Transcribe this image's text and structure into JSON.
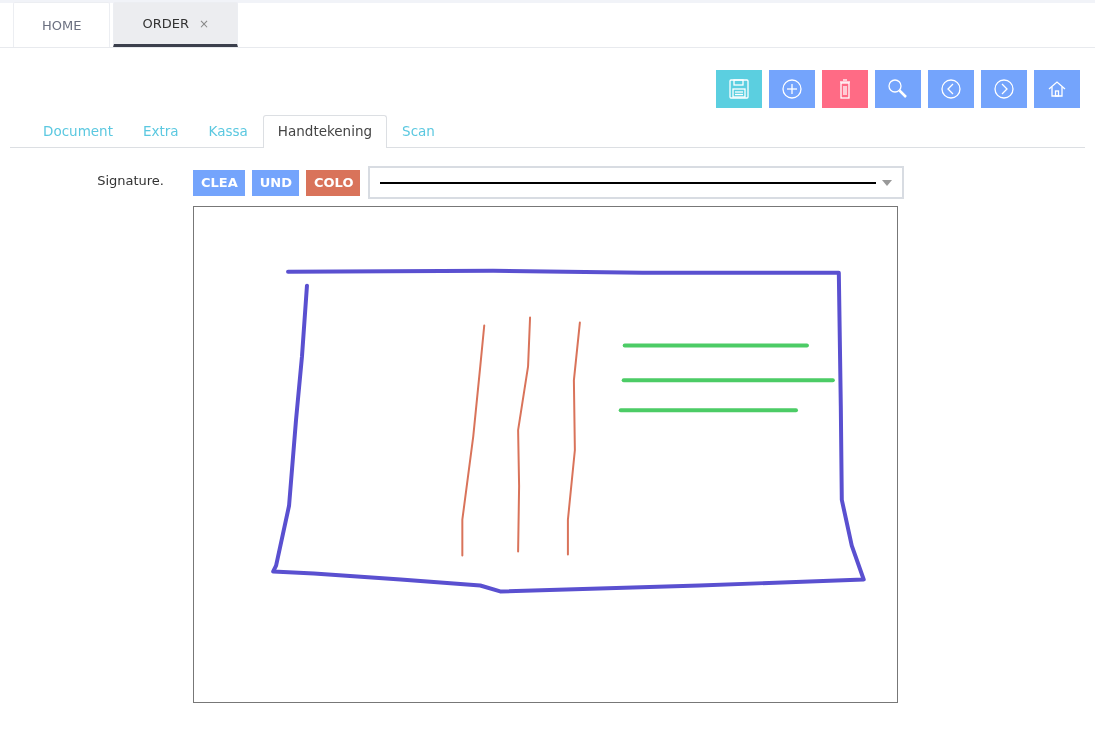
{
  "tabs": [
    {
      "label": "HOME",
      "selected": false
    },
    {
      "label": "ORDER",
      "selected": true,
      "close_label": "×"
    }
  ],
  "toolbar": [
    {
      "kind": "save",
      "color": "#5bcfe0"
    },
    {
      "kind": "add",
      "color": "#74a4fc"
    },
    {
      "kind": "delete",
      "color": "#ff6b85"
    },
    {
      "kind": "search",
      "color": "#74a4fc"
    },
    {
      "kind": "previous",
      "color": "#74a4fc"
    },
    {
      "kind": "next",
      "color": "#74a4fc"
    },
    {
      "kind": "home",
      "color": "#74a4fc"
    }
  ],
  "subtabs": [
    {
      "label": "Document",
      "selected": false
    },
    {
      "label": "Extra",
      "selected": false
    },
    {
      "label": "Kassa",
      "selected": false
    },
    {
      "label": "Handtekening",
      "selected": true
    },
    {
      "label": "Scan",
      "selected": false
    }
  ],
  "signature": {
    "label": "Signature.",
    "buttons": [
      {
        "label": "CLEA",
        "color": "#74a4fc"
      },
      {
        "label": "UND",
        "color": "#74a4fc"
      },
      {
        "label": "COLO",
        "color": "#d9735a"
      }
    ]
  }
}
